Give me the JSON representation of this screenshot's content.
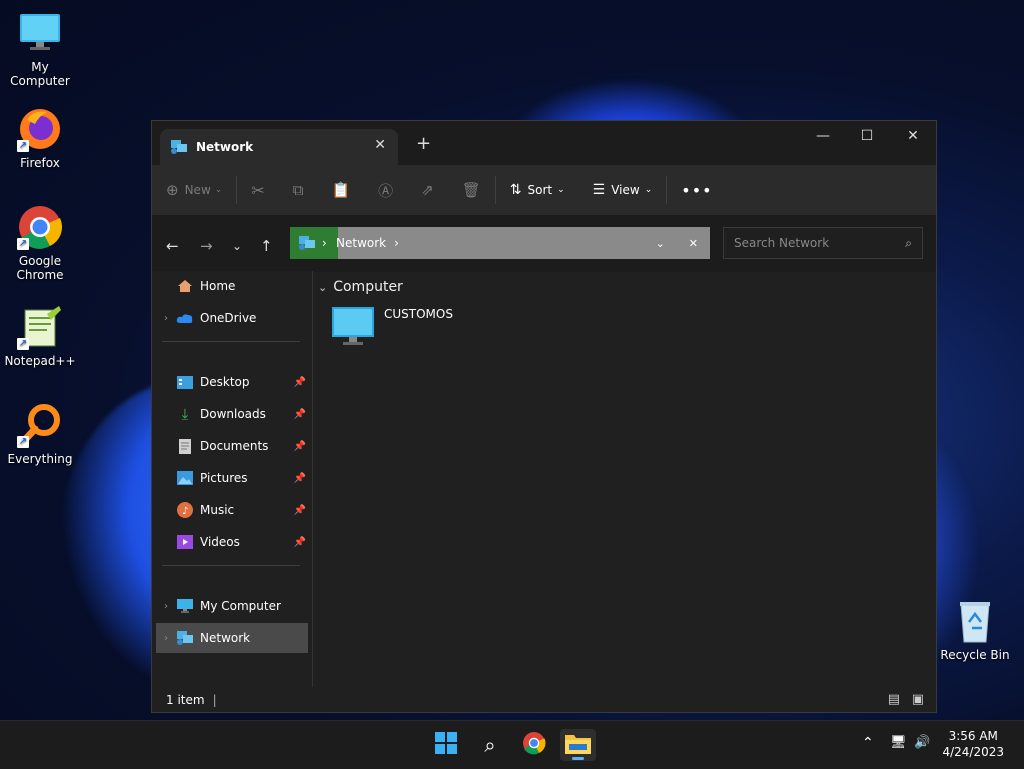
{
  "desktop": {
    "icons": [
      {
        "label": "My Computer"
      },
      {
        "label": "Firefox"
      },
      {
        "label_line1": "Google",
        "label_line2": "Chrome"
      },
      {
        "label": "Notepad++"
      },
      {
        "label": "Everything"
      },
      {
        "label": "Recycle Bin"
      }
    ]
  },
  "window": {
    "tab_title": "Network",
    "toolbar": {
      "new_label": "New",
      "sort_label": "Sort",
      "view_label": "View"
    },
    "address": {
      "crumb": "Network",
      "search_placeholder": "Search Network"
    },
    "sidebar": {
      "items": [
        {
          "label": "Home"
        },
        {
          "label": "OneDrive"
        },
        {
          "label": "Desktop"
        },
        {
          "label": "Downloads"
        },
        {
          "label": "Documents"
        },
        {
          "label": "Pictures"
        },
        {
          "label": "Music"
        },
        {
          "label": "Videos"
        },
        {
          "label": "My Computer"
        },
        {
          "label": "Network"
        }
      ]
    },
    "content": {
      "group_header": "Computer",
      "items": [
        {
          "label": "CUSTOMOS"
        }
      ]
    },
    "status": {
      "count": "1 item"
    }
  },
  "taskbar": {
    "time": "3:56 AM",
    "date": "4/24/2023"
  },
  "colors": {
    "accent": "#5fb2f2",
    "address_icon_bg": "#2e7d32"
  }
}
